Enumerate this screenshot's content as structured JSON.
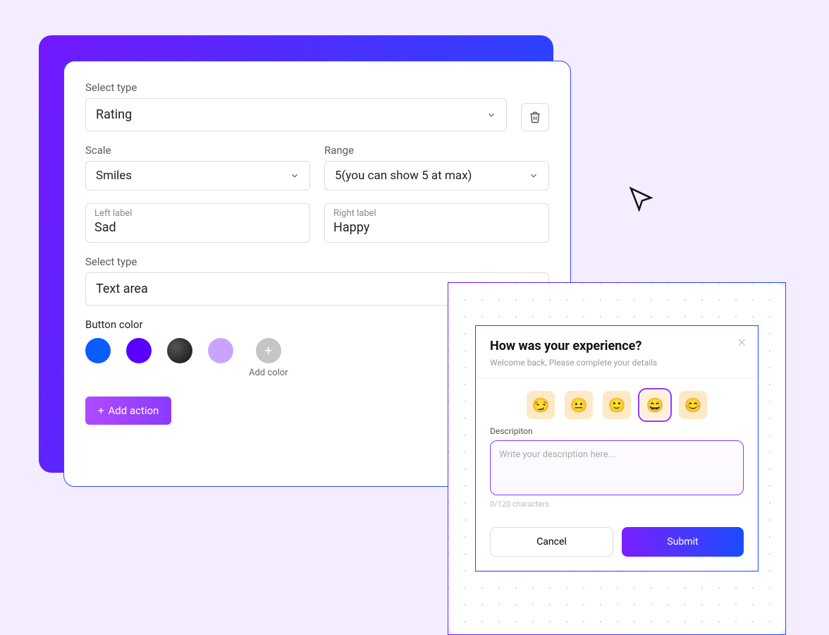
{
  "builder": {
    "type_label": "Select type",
    "type_value": "Rating",
    "scale_label": "Scale",
    "scale_value": "Smiles",
    "range_label": "Range",
    "range_value": "5(you can show 5 at max)",
    "left_label_caption": "Left label",
    "left_label_value": "Sad",
    "right_label_caption": "Right label",
    "right_label_value": "Happy",
    "type2_label": "Select type",
    "type2_value": "Text area",
    "button_color_label": "Button color",
    "swatches": [
      "#0b5cff",
      "#5a00ff",
      "#2b2b2b",
      "#c9a4ff"
    ],
    "add_color_label": "Add color",
    "add_action_label": "Add action"
  },
  "preview": {
    "title": "How was your experience?",
    "subtitle": "Welcome back, Please complete your details",
    "emojis": [
      "😏",
      "😐",
      "🙂",
      "😄",
      "😊"
    ],
    "selected_emoji_index": 3,
    "description_label": "Descripiton",
    "description_placeholder": "Write your description here...",
    "char_count": "0/120 characters",
    "cancel_label": "Cancel",
    "submit_label": "Submit"
  }
}
